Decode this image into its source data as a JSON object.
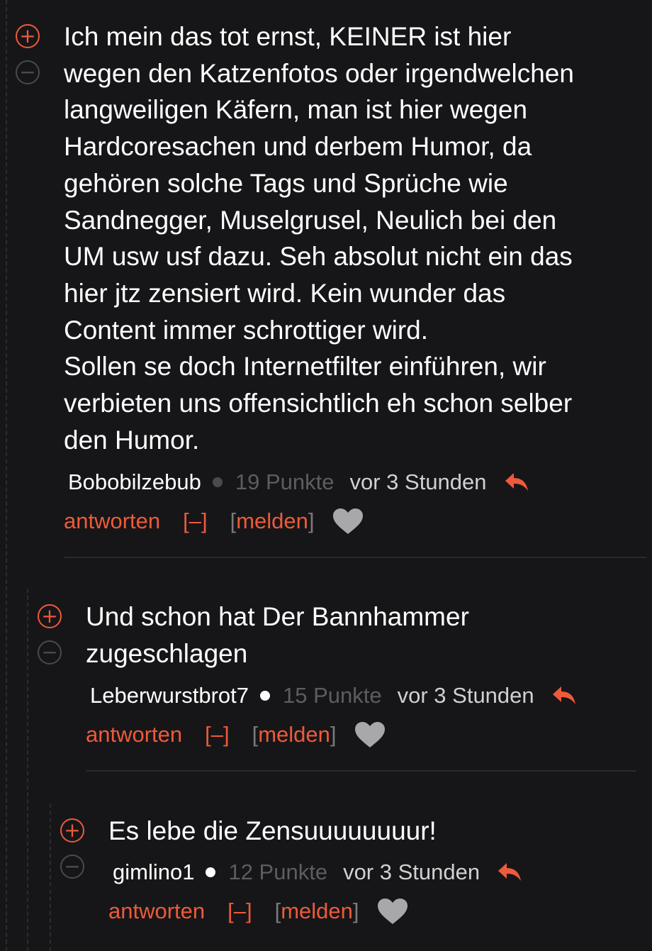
{
  "colors": {
    "background": "#161618",
    "accent": "#ee5a3a",
    "text": "#ffffff",
    "muted": "#5d5d60",
    "heart": "#a8a8aa"
  },
  "icons": {
    "upvote": "plus-circle-icon",
    "downvote": "minus-circle-icon",
    "reply": "reply-arrow-icon",
    "favorite": "heart-icon"
  },
  "labels": {
    "upvote": "+",
    "downvote": "−",
    "reply": "antworten",
    "collapse": "[–]",
    "report_open": "[",
    "report": "melden",
    "report_close": "]"
  },
  "comments": [
    {
      "text": "Ich mein das tot ernst, KEINER ist hier\nwegen den Katzenfotos oder irgendwelchen\nlangweiligen Käfern, man ist hier wegen\nHardcoresachen und derbem Humor, da\ngehören solche Tags und Sprüche wie\nSandnegger, Muselgrusel, Neulich bei den\nUM usw usf dazu. Seh absolut nicht ein das\nhier jtz zensiert wird. Kein wunder das\nContent immer schrottiger wird.\nSollen se doch Internetfilter einführen, wir\nverbieten uns offensichtlich eh schon selber\nden Humor.",
      "author": "Bobobilzebub",
      "points": "19 Punkte",
      "time": "vor 3 Stunden"
    },
    {
      "text": "Und schon hat Der Bannhammer\nzugeschlagen",
      "author": "Leberwurstbrot7",
      "points": "15 Punkte",
      "time": "vor 3 Stunden"
    },
    {
      "text": "Es lebe die Zensuuuuuuuur!",
      "author": "gimlino1",
      "points": "12 Punkte",
      "time": "vor 3 Stunden"
    }
  ]
}
